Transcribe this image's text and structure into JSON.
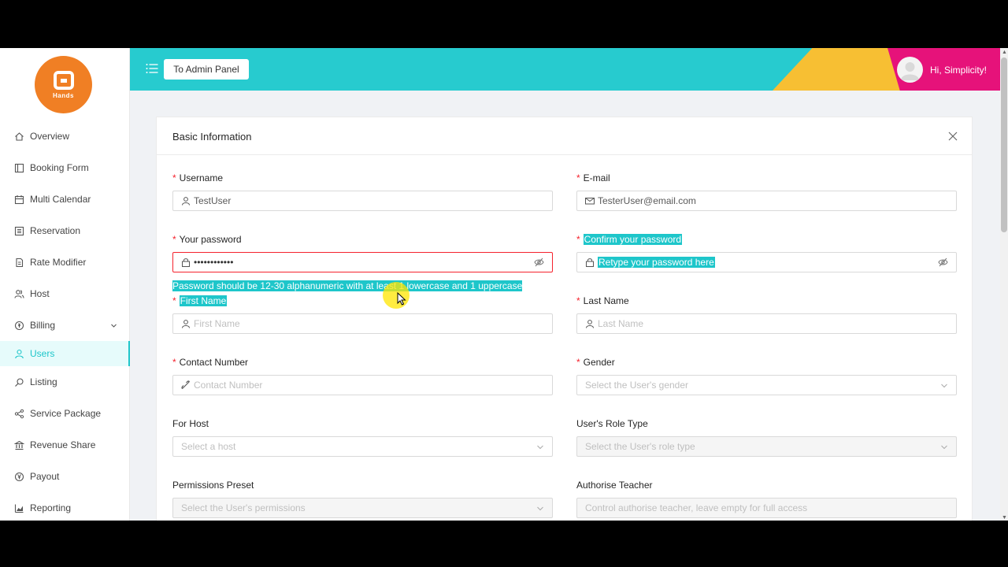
{
  "logo": {
    "text": "Hands"
  },
  "sidebar": {
    "items": [
      {
        "label": "Overview",
        "icon": "home-icon"
      },
      {
        "label": "Booking Form",
        "icon": "form-icon"
      },
      {
        "label": "Multi Calendar",
        "icon": "calendar-icon"
      },
      {
        "label": "Reservation",
        "icon": "list-icon"
      },
      {
        "label": "Rate Modifier",
        "icon": "file-icon"
      },
      {
        "label": "Host",
        "icon": "host-icon"
      },
      {
        "label": "Billing",
        "icon": "billing-icon"
      },
      {
        "label": "Users",
        "icon": "user-icon"
      },
      {
        "label": "Listing",
        "icon": "search-icon"
      },
      {
        "label": "Service Package",
        "icon": "share-icon"
      },
      {
        "label": "Revenue Share",
        "icon": "bank-icon"
      },
      {
        "label": "Payout",
        "icon": "yen-icon"
      },
      {
        "label": "Reporting",
        "icon": "chart-icon"
      }
    ]
  },
  "header": {
    "admin_button": "To Admin Panel",
    "greeting": "Hi, Simplicity!"
  },
  "form": {
    "title": "Basic Information",
    "username": {
      "label": "Username",
      "value": "TestUser"
    },
    "email": {
      "label": "E-mail",
      "value": "TesterUser@email.com"
    },
    "password": {
      "label": "Your password",
      "value": "••••••••••••",
      "error": "Password should be 12-30 alphanumeric with at least 1 lowercase and 1 uppercase"
    },
    "confirm_password": {
      "label": "Confirm your password",
      "placeholder": "Retype your password here"
    },
    "first_name": {
      "label": "First Name",
      "placeholder": "First Name"
    },
    "last_name": {
      "label": "Last Name",
      "placeholder": "Last Name"
    },
    "contact": {
      "label": "Contact Number",
      "placeholder": "Contact Number"
    },
    "gender": {
      "label": "Gender",
      "placeholder": "Select the User's gender"
    },
    "for_host": {
      "label": "For Host",
      "placeholder": "Select a host"
    },
    "role_type": {
      "label": "User's Role Type",
      "placeholder": "Select the User's role type"
    },
    "permissions": {
      "label": "Permissions Preset",
      "placeholder": "Select the User's permissions"
    },
    "authorise_teacher": {
      "label": "Authorise Teacher",
      "placeholder": "Control authorise teacher, leave empty for full access"
    }
  },
  "colors": {
    "accent": "#1ec6ca",
    "header_teal": "#27cbcf",
    "header_yellow": "#f7bf33",
    "header_pink": "#e6127a",
    "logo_orange": "#f07f24",
    "error": "#f5222d"
  }
}
